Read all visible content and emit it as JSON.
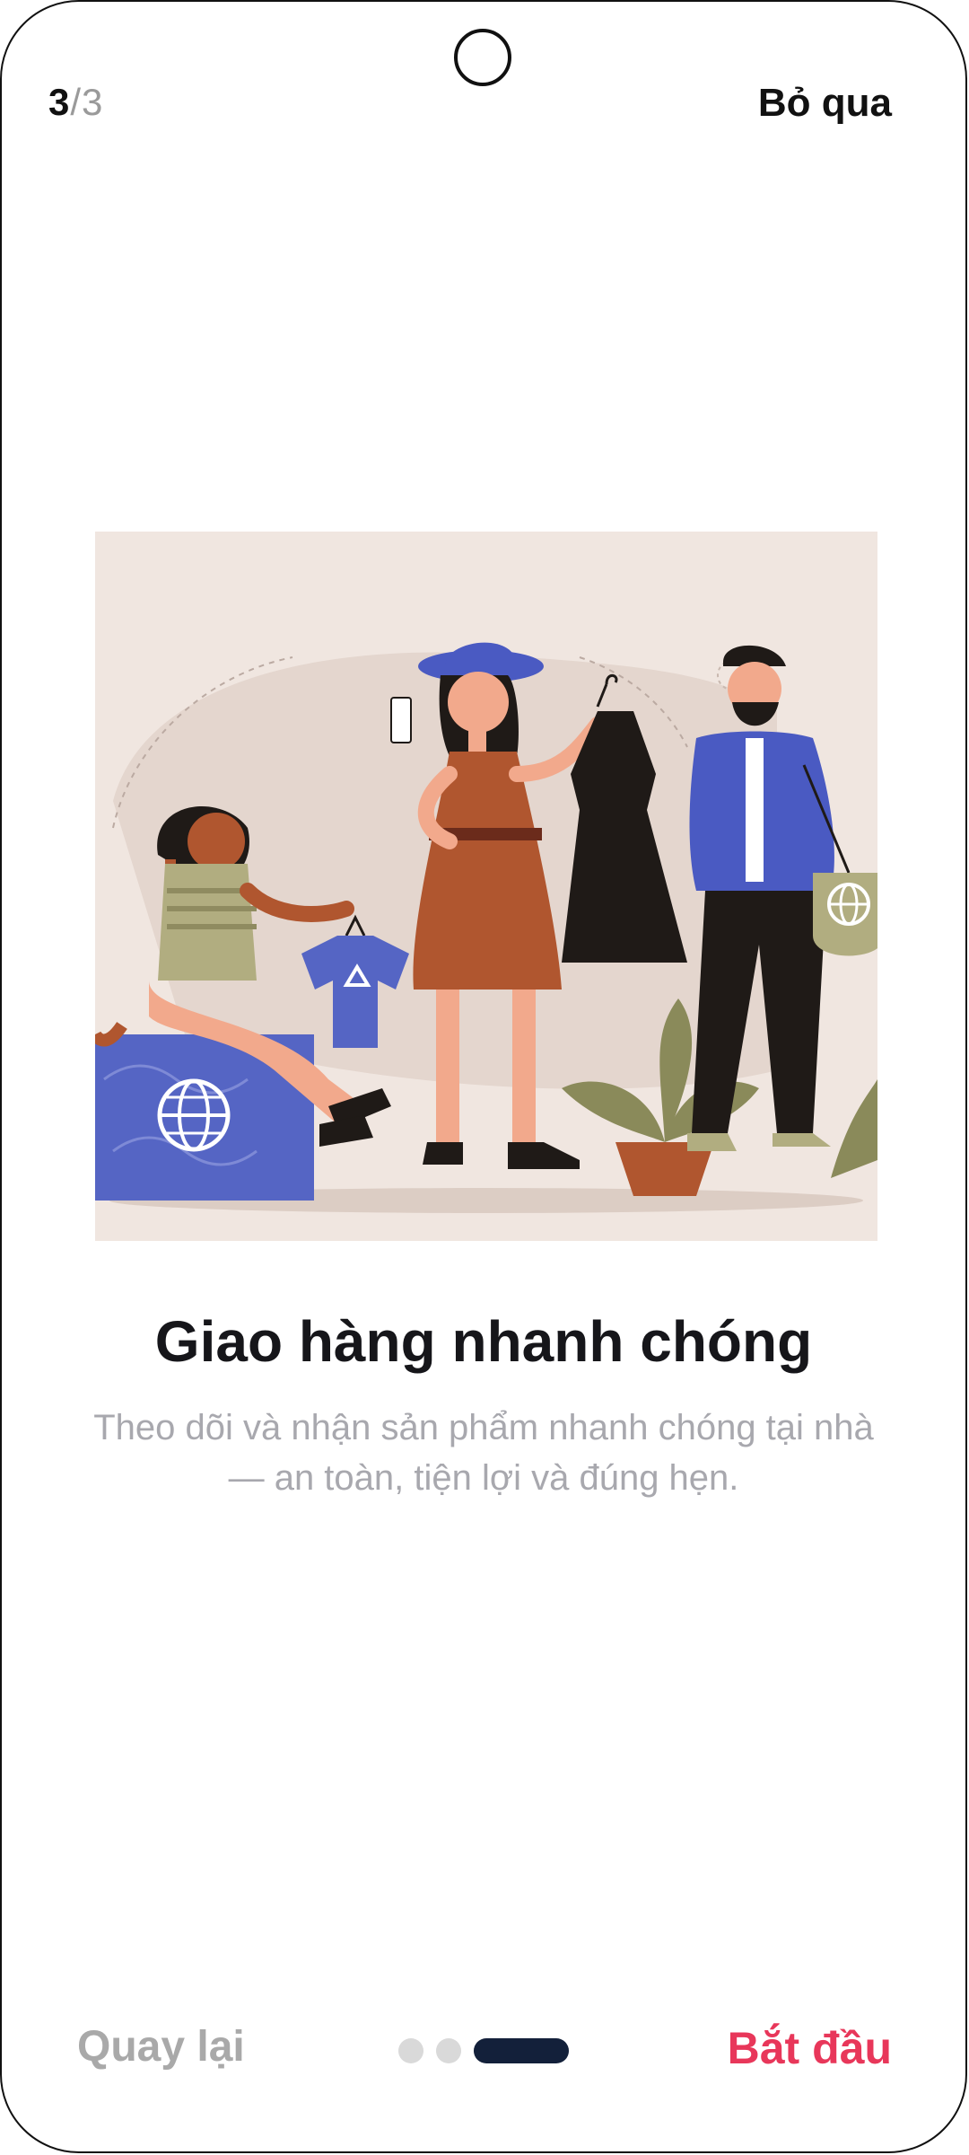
{
  "header": {
    "step_current": "3",
    "step_total": "/3",
    "skip_label": "Bỏ qua"
  },
  "content": {
    "title": "Giao hàng nhanh chóng",
    "subtitle": "Theo dõi và nhận sản phẩm nhanh chóng tại nhà — an toàn, tiện lợi và đúng hẹn.",
    "illustration_icons": [
      "recycle-icon",
      "globe-icon"
    ]
  },
  "footer": {
    "back_label": "Quay lại",
    "start_label": "Bắt đầu",
    "pager": {
      "count": 3,
      "active_index": 2
    }
  },
  "colors": {
    "accent": "#e8375a",
    "pager_active": "#13203a",
    "pager_inactive": "#d9d9d9",
    "illustration_bg": "#f0e6e0"
  }
}
